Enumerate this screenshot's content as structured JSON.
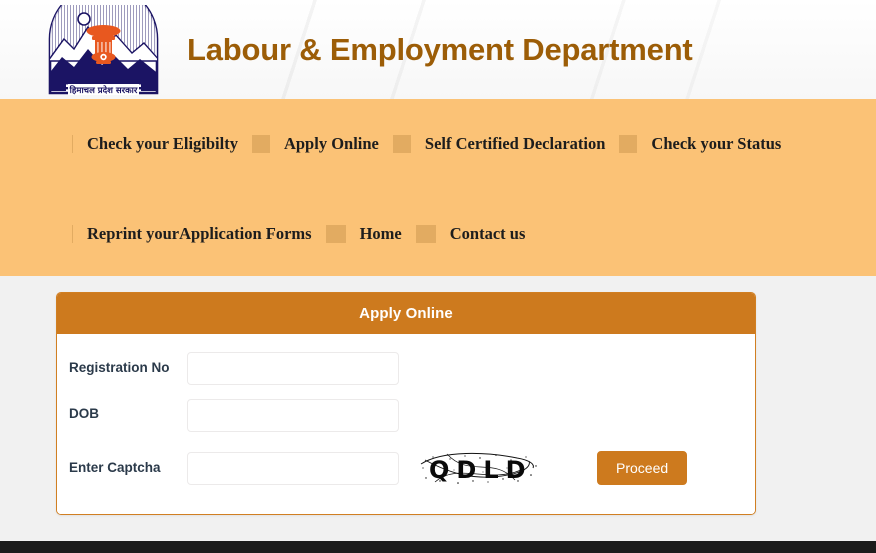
{
  "header": {
    "title": "Labour & Employment Department",
    "logo_alt": "Himachal Pradesh Government Emblem",
    "logo_caption": "हिमाचल प्रदेश सरकार",
    "title_color": "#9c5d07"
  },
  "nav": {
    "background_color": "#fbc276",
    "row1": [
      {
        "label": "Check your Eligibilty"
      },
      {
        "label": "Apply Online"
      },
      {
        "label": "Self Certified Declaration"
      },
      {
        "label": "Check your Status"
      }
    ],
    "row2": [
      {
        "label": "Reprint yourApplication Forms"
      },
      {
        "label": "Home"
      },
      {
        "label": "Contact us"
      }
    ]
  },
  "panel": {
    "heading": "Apply Online",
    "heading_bg": "#cd7a1e",
    "border_color": "#d17f22",
    "fields": [
      {
        "label": "Registration No",
        "value": "",
        "placeholder": ""
      },
      {
        "label": "DOB",
        "value": "",
        "placeholder": ""
      },
      {
        "label": "Enter Captcha",
        "value": "",
        "placeholder": ""
      }
    ],
    "captcha": {
      "text": "QDLD",
      "alt": "captcha-image"
    },
    "submit": {
      "label": "Proceed",
      "color": "#cd7a1e"
    }
  },
  "footer": {
    "background_color": "#1b1b1b"
  }
}
